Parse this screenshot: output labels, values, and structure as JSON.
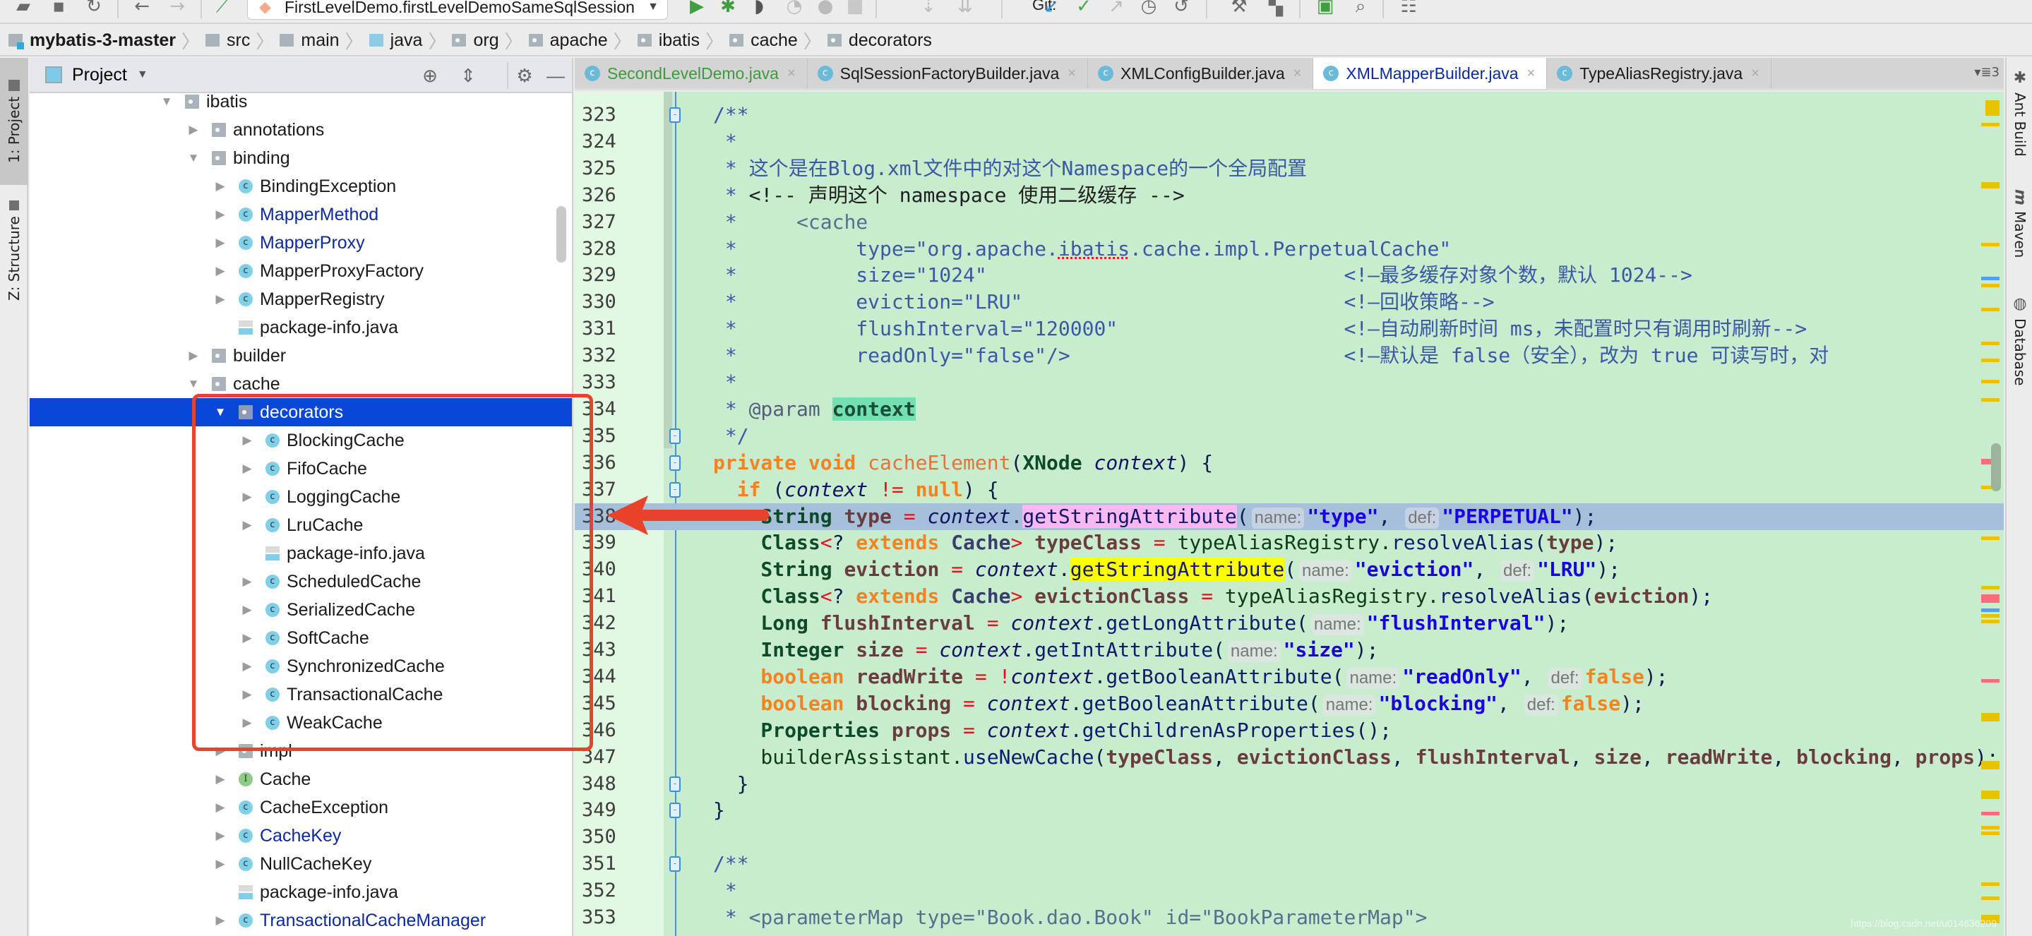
{
  "toolbar": {
    "run_config": "FirstLevelDemo.firstLevelDemoSameSqlSession",
    "git_label": "Git:",
    "icons": [
      "open-icon",
      "save-icon",
      "sync-icon",
      "back-icon",
      "forward-icon",
      "build-icon",
      "run-icon",
      "debug-icon",
      "coverage-icon",
      "profile-icon",
      "attach-icon",
      "stop-icon",
      "git-update-icon",
      "git-commit-icon",
      "git-push-icon",
      "git-history-icon",
      "git-revert-icon",
      "settings-icon",
      "project-structure-icon",
      "run-anything-icon",
      "search-icon",
      "vcs-icon"
    ]
  },
  "breadcrumb": [
    {
      "label": "mybatis-3-master",
      "kind": "module"
    },
    {
      "label": "src",
      "kind": "folder"
    },
    {
      "label": "main",
      "kind": "folder"
    },
    {
      "label": "java",
      "kind": "java"
    },
    {
      "label": "org",
      "kind": "pkg"
    },
    {
      "label": "apache",
      "kind": "pkg"
    },
    {
      "label": "ibatis",
      "kind": "pkg"
    },
    {
      "label": "cache",
      "kind": "pkg"
    },
    {
      "label": "decorators",
      "kind": "pkg"
    }
  ],
  "left_strip": {
    "project_tab": "1: Project",
    "structure_tab": "Z: Structure"
  },
  "project_panel": {
    "title": "Project",
    "tree": [
      {
        "label": "ibatis",
        "type": "folder",
        "depth": 0,
        "expanded": true
      },
      {
        "label": "annotations",
        "type": "folder",
        "depth": 1,
        "expanded": false
      },
      {
        "label": "binding",
        "type": "folder",
        "depth": 1,
        "expanded": true
      },
      {
        "label": "BindingException",
        "type": "class",
        "depth": 2
      },
      {
        "label": "MapperMethod",
        "type": "class",
        "depth": 2,
        "modified": true
      },
      {
        "label": "MapperProxy",
        "type": "class",
        "depth": 2,
        "modified": true
      },
      {
        "label": "MapperProxyFactory",
        "type": "class",
        "depth": 2
      },
      {
        "label": "MapperRegistry",
        "type": "class",
        "depth": 2
      },
      {
        "label": "package-info.java",
        "type": "file",
        "depth": 2
      },
      {
        "label": "builder",
        "type": "folder",
        "depth": 1,
        "expanded": false
      },
      {
        "label": "cache",
        "type": "folder",
        "depth": 1,
        "expanded": true
      },
      {
        "label": "decorators",
        "type": "folder",
        "depth": 2,
        "expanded": true,
        "selected": true
      },
      {
        "label": "BlockingCache",
        "type": "class",
        "depth": 3
      },
      {
        "label": "FifoCache",
        "type": "class",
        "depth": 3
      },
      {
        "label": "LoggingCache",
        "type": "class",
        "depth": 3
      },
      {
        "label": "LruCache",
        "type": "class",
        "depth": 3
      },
      {
        "label": "package-info.java",
        "type": "file",
        "depth": 3
      },
      {
        "label": "ScheduledCache",
        "type": "class",
        "depth": 3
      },
      {
        "label": "SerializedCache",
        "type": "class",
        "depth": 3
      },
      {
        "label": "SoftCache",
        "type": "class",
        "depth": 3
      },
      {
        "label": "SynchronizedCache",
        "type": "class",
        "depth": 3
      },
      {
        "label": "TransactionalCache",
        "type": "class",
        "depth": 3
      },
      {
        "label": "WeakCache",
        "type": "class",
        "depth": 3
      },
      {
        "label": "impl",
        "type": "folder",
        "depth": 2,
        "expanded": false
      },
      {
        "label": "Cache",
        "type": "interface",
        "depth": 2
      },
      {
        "label": "CacheException",
        "type": "class",
        "depth": 2
      },
      {
        "label": "CacheKey",
        "type": "class",
        "depth": 2,
        "modified": true
      },
      {
        "label": "NullCacheKey",
        "type": "class",
        "depth": 2
      },
      {
        "label": "package-info.java",
        "type": "file",
        "depth": 2
      },
      {
        "label": "TransactionalCacheManager",
        "type": "class",
        "depth": 2,
        "modified": true
      }
    ]
  },
  "tabs": [
    {
      "label": "SecondLevelDemo.java",
      "style": "green"
    },
    {
      "label": "SqlSessionFactoryBuilder.java"
    },
    {
      "label": "XMLConfigBuilder.java"
    },
    {
      "label": "XMLMapperBuilder.java",
      "active": true
    },
    {
      "label": "TypeAliasRegistry.java"
    }
  ],
  "tab_overflow": "▾≣3",
  "right_strip": {
    "ant": "Ant Build",
    "maven": "Maven",
    "database": "Database"
  },
  "editor": {
    "current_line": 338,
    "lines": [
      {
        "n": "323",
        "fold": "open",
        "tokens": [
          [
            "c-doc",
            "/**"
          ]
        ]
      },
      {
        "n": "324",
        "tokens": [
          [
            "c-doc",
            " *"
          ]
        ]
      },
      {
        "n": "325",
        "tokens": [
          [
            "c-doc",
            " * 这个是在Blog.xml文件中的对这个Namespace的一个全局配置"
          ]
        ]
      },
      {
        "n": "326",
        "tokens": [
          [
            "c-doc",
            " * "
          ],
          [
            "c-html",
            "<!-- 声明这个 namespace 使用二级缓存 -->"
          ]
        ]
      },
      {
        "n": "327",
        "tokens": [
          [
            "c-doc",
            " *     "
          ],
          [
            "c-xml",
            "<cache"
          ]
        ]
      },
      {
        "n": "328",
        "tokens": [
          [
            "c-doc",
            " *          type=\"org.apache."
          ],
          [
            "c-doc spell",
            "ibatis"
          ],
          [
            "c-doc",
            ".cache.impl.PerpetualCache\""
          ]
        ]
      },
      {
        "n": "329",
        "tokens": [
          [
            "c-doc",
            " *          size=\"1024\"                              <!—最多缓存对象个数，默认 1024-->"
          ]
        ]
      },
      {
        "n": "330",
        "tokens": [
          [
            "c-doc",
            " *          eviction=\"LRU\"                           <!—回收策略-->"
          ]
        ]
      },
      {
        "n": "331",
        "tokens": [
          [
            "c-doc",
            " *          flushInterval=\"120000\"                   <!—自动刷新时间 ms，未配置时只有调用时刷新-->"
          ]
        ]
      },
      {
        "n": "332",
        "tokens": [
          [
            "c-doc",
            " *          readOnly=\"false\"/>                       <!—默认是 false（安全），改为 true 可读写时，对"
          ]
        ]
      },
      {
        "n": "333",
        "tokens": [
          [
            "c-doc",
            " *"
          ]
        ]
      },
      {
        "n": "334",
        "tokens": [
          [
            "c-doc",
            " * "
          ],
          [
            "c-doctag",
            "@param"
          ],
          [
            "c-doc",
            " "
          ],
          [
            "hl-param",
            "context"
          ]
        ]
      },
      {
        "n": "335",
        "fold": "close",
        "tokens": [
          [
            "c-doc",
            " */"
          ]
        ]
      },
      {
        "n": "336",
        "fold": "open",
        "tokens": [
          [
            "c-kw",
            "private void "
          ],
          [
            "c-fn",
            "cacheElement"
          ],
          [
            "c-punct",
            "("
          ],
          [
            "c-type",
            "XNode "
          ],
          [
            "c-param",
            "context"
          ],
          [
            "c-punct",
            ") {"
          ]
        ]
      },
      {
        "n": "337",
        "fold": "open",
        "tokens": [
          [
            "c-kw",
            "  if "
          ],
          [
            "c-punct",
            "("
          ],
          [
            "c-param",
            "context "
          ],
          [
            "c-op",
            "!= "
          ],
          [
            "c-kw",
            "null"
          ],
          [
            "c-punct",
            ") {"
          ]
        ]
      },
      {
        "n": "338",
        "tokens": [
          [
            "c-type",
            "    String "
          ],
          [
            "c-var",
            "type "
          ],
          [
            "c-op",
            "= "
          ],
          [
            "c-param",
            "context"
          ],
          [
            "c-punct",
            "."
          ],
          [
            "c-call hl-pink",
            "getStringAttribute"
          ],
          [
            "c-punct",
            "("
          ],
          [
            "hint",
            "name:"
          ],
          [
            "c-str",
            "\"type\""
          ],
          [
            "c-punct",
            ", "
          ],
          [
            "hint",
            "def:"
          ],
          [
            "c-str",
            "\"PERPETUAL\""
          ],
          [
            "c-punct",
            ");"
          ]
        ]
      },
      {
        "n": "339",
        "tokens": [
          [
            "c-type",
            "    Class"
          ],
          [
            "c-op",
            "<"
          ],
          [
            "c-punct",
            "? "
          ],
          [
            "c-kw",
            "extends "
          ],
          [
            "c-generic",
            "Cache"
          ],
          [
            "c-op",
            "> "
          ],
          [
            "c-var",
            "typeClass "
          ],
          [
            "c-op",
            "= "
          ],
          [
            "c-plain",
            "typeAliasRegistry."
          ],
          [
            "c-call",
            "resolveAlias"
          ],
          [
            "c-punct",
            "("
          ],
          [
            "c-var",
            "type"
          ],
          [
            "c-punct",
            ");"
          ]
        ]
      },
      {
        "n": "340",
        "tokens": [
          [
            "c-type",
            "    String "
          ],
          [
            "c-var",
            "eviction "
          ],
          [
            "c-op",
            "= "
          ],
          [
            "c-param",
            "context"
          ],
          [
            "c-punct",
            "."
          ],
          [
            "c-call hl-yellow",
            "getStringAttribute"
          ],
          [
            "c-punct",
            "("
          ],
          [
            "hint",
            "name:"
          ],
          [
            "c-str",
            "\"eviction\""
          ],
          [
            "c-punct",
            ", "
          ],
          [
            "hint",
            "def:"
          ],
          [
            "c-str",
            "\"LRU\""
          ],
          [
            "c-punct",
            ");"
          ]
        ]
      },
      {
        "n": "341",
        "tokens": [
          [
            "c-type",
            "    Class"
          ],
          [
            "c-op",
            "<"
          ],
          [
            "c-punct",
            "? "
          ],
          [
            "c-kw",
            "extends "
          ],
          [
            "c-generic",
            "Cache"
          ],
          [
            "c-op",
            "> "
          ],
          [
            "c-var",
            "evictionClass "
          ],
          [
            "c-op",
            "= "
          ],
          [
            "c-plain",
            "typeAliasRegistry."
          ],
          [
            "c-call",
            "resolveAlias"
          ],
          [
            "c-punct",
            "("
          ],
          [
            "c-var",
            "eviction"
          ],
          [
            "c-punct",
            ");"
          ]
        ]
      },
      {
        "n": "342",
        "tokens": [
          [
            "c-type",
            "    Long "
          ],
          [
            "c-var",
            "flushInterval "
          ],
          [
            "c-op",
            "= "
          ],
          [
            "c-param",
            "context"
          ],
          [
            "c-punct",
            "."
          ],
          [
            "c-call",
            "getLongAttribute"
          ],
          [
            "c-punct",
            "("
          ],
          [
            "hint",
            "name:"
          ],
          [
            "c-str",
            "\"flushInterval\""
          ],
          [
            "c-punct",
            ");"
          ]
        ]
      },
      {
        "n": "343",
        "tokens": [
          [
            "c-type",
            "    Integer "
          ],
          [
            "c-var",
            "size "
          ],
          [
            "c-op",
            "= "
          ],
          [
            "c-param",
            "context"
          ],
          [
            "c-punct",
            "."
          ],
          [
            "c-call",
            "getIntAttribute"
          ],
          [
            "c-punct",
            "("
          ],
          [
            "hint",
            "name:"
          ],
          [
            "c-str",
            "\"size\""
          ],
          [
            "c-punct",
            ");"
          ]
        ]
      },
      {
        "n": "344",
        "tokens": [
          [
            "c-kw",
            "    boolean "
          ],
          [
            "c-var",
            "readWrite "
          ],
          [
            "c-op",
            "= !"
          ],
          [
            "c-param",
            "context"
          ],
          [
            "c-punct",
            "."
          ],
          [
            "c-call",
            "getBooleanAttribute"
          ],
          [
            "c-punct",
            "("
          ],
          [
            "hint",
            "name:"
          ],
          [
            "c-str",
            "\"readOnly\""
          ],
          [
            "c-punct",
            ", "
          ],
          [
            "hint",
            "def:"
          ],
          [
            "c-kw",
            "false"
          ],
          [
            "c-punct",
            ");"
          ]
        ]
      },
      {
        "n": "345",
        "tokens": [
          [
            "c-kw",
            "    boolean "
          ],
          [
            "c-var",
            "blocking "
          ],
          [
            "c-op",
            "= "
          ],
          [
            "c-param",
            "context"
          ],
          [
            "c-punct",
            "."
          ],
          [
            "c-call",
            "getBooleanAttribute"
          ],
          [
            "c-punct",
            "("
          ],
          [
            "hint",
            "name:"
          ],
          [
            "c-str",
            "\"blocking\""
          ],
          [
            "c-punct",
            ", "
          ],
          [
            "hint",
            "def:"
          ],
          [
            "c-kw",
            "false"
          ],
          [
            "c-punct",
            ");"
          ]
        ]
      },
      {
        "n": "346",
        "tokens": [
          [
            "c-type",
            "    Properties "
          ],
          [
            "c-var",
            "props "
          ],
          [
            "c-op",
            "= "
          ],
          [
            "c-param",
            "context"
          ],
          [
            "c-punct",
            "."
          ],
          [
            "c-call",
            "getChildrenAsProperties"
          ],
          [
            "c-punct",
            "();"
          ]
        ]
      },
      {
        "n": "347",
        "tokens": [
          [
            "c-plain",
            "    builderAssistant."
          ],
          [
            "c-call",
            "useNewCache"
          ],
          [
            "c-punct",
            "("
          ],
          [
            "c-var",
            "typeClass"
          ],
          [
            "c-punct",
            ", "
          ],
          [
            "c-var",
            "evictionClass"
          ],
          [
            "c-punct",
            ", "
          ],
          [
            "c-var",
            "flushInterval"
          ],
          [
            "c-punct",
            ", "
          ],
          [
            "c-var",
            "size"
          ],
          [
            "c-punct",
            ", "
          ],
          [
            "c-var",
            "readWrite"
          ],
          [
            "c-punct",
            ", "
          ],
          [
            "c-var",
            "blocking"
          ],
          [
            "c-punct",
            ", "
          ],
          [
            "c-var",
            "props"
          ],
          [
            "c-punct",
            ");"
          ]
        ]
      },
      {
        "n": "348",
        "fold": "close",
        "tokens": [
          [
            "c-punct",
            "  }"
          ]
        ]
      },
      {
        "n": "349",
        "fold": "close",
        "tokens": [
          [
            "c-punct",
            "}"
          ]
        ]
      },
      {
        "n": "350",
        "tokens": []
      },
      {
        "n": "351",
        "fold": "open",
        "tokens": [
          [
            "c-doc",
            "/**"
          ]
        ]
      },
      {
        "n": "352",
        "tokens": [
          [
            "c-doc",
            " *"
          ]
        ]
      },
      {
        "n": "353",
        "tokens": [
          [
            "c-doc",
            " * "
          ],
          [
            "c-xml",
            "<parameterMap type=\"Book.dao.Book\" id=\"BookParameterMap\">"
          ]
        ]
      }
    ]
  },
  "watermark": "https://blog.csdn.net/u014636209"
}
